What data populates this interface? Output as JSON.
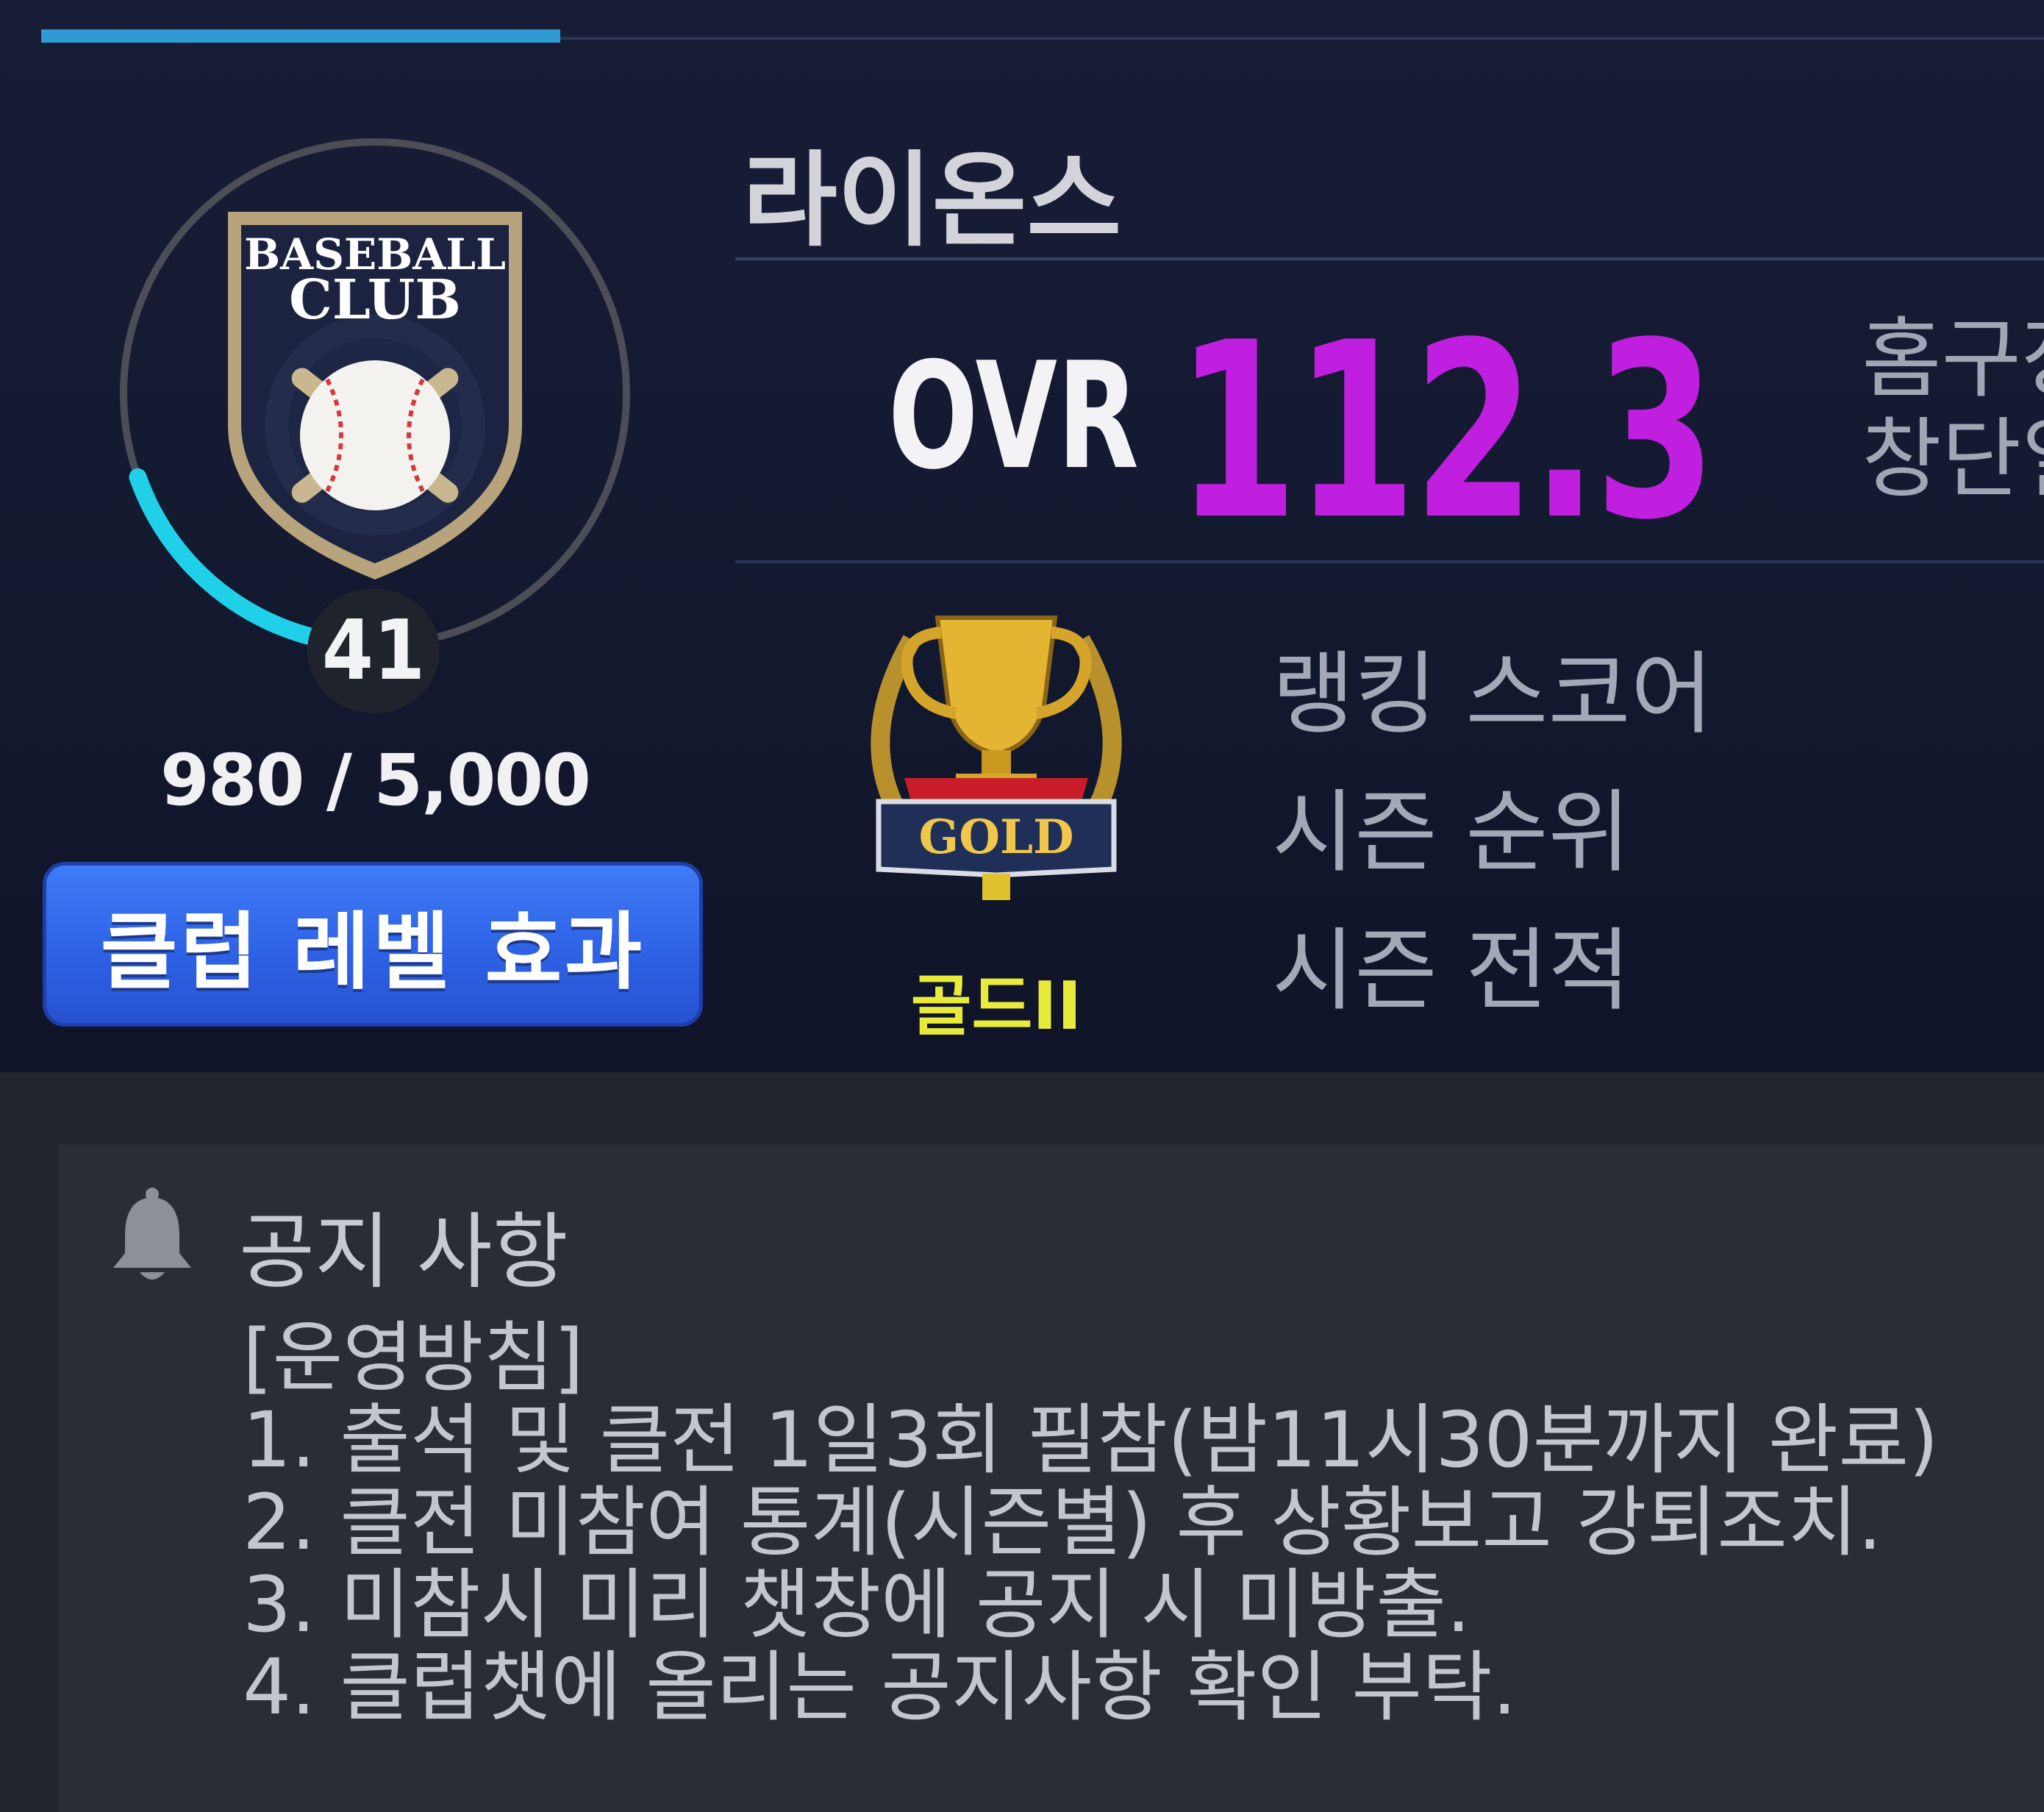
{
  "club": {
    "name": "라이온스",
    "level": "41",
    "xp_text": "980 / 5,000",
    "xp_progress": 0.196,
    "level_effect_button": "클럽 레벨 효과",
    "emblem_text_line1": "BASEBALL",
    "emblem_text_line2": "CLUB"
  },
  "overview": {
    "ovr_label": "OVR",
    "ovr_value": "112.3",
    "home_stadium_label": "홈구장",
    "founded_label": "창단일"
  },
  "ranking": {
    "tier_badge_text": "GOLD",
    "tier_label": "골드II",
    "stats": [
      "랭킹 스코어",
      "시즌 순위",
      "시즌 전적"
    ]
  },
  "notice": {
    "title": "공지 사항",
    "lines": [
      "[운영방침]",
      "1. 출석 및 클전 1일3회 필참(밤11시30분까지 완료)",
      "2. 클전 미참여 통계(시즌별) 후 상황보고 강퇴조치.",
      "3. 미참시 미리 챗창에 공지 시 미방출.",
      "4. 클럽챗에 올리는 공지사항 확인 부탁."
    ]
  },
  "colors": {
    "ovr_value": "#c01fe0",
    "tier_label": "#e9ea3a",
    "level_ring_progress": "#1fd0e8",
    "button": "#3467ea",
    "tab_active": "#2f9ad4"
  }
}
